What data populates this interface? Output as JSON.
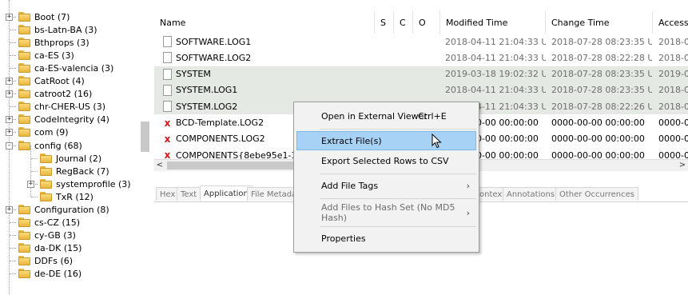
{
  "tree": {
    "items": [
      {
        "label": "Boot (7)",
        "expander": "+"
      },
      {
        "label": "bs-Latn-BA (3)",
        "expander": ""
      },
      {
        "label": "Bthprops (3)",
        "expander": ""
      },
      {
        "label": "ca-ES (3)",
        "expander": ""
      },
      {
        "label": "ca-ES-valencia (3)",
        "expander": ""
      },
      {
        "label": "CatRoot (4)",
        "expander": "+"
      },
      {
        "label": "catroot2 (16)",
        "expander": "+"
      },
      {
        "label": "chr-CHER-US (3)",
        "expander": ""
      },
      {
        "label": "CodeIntegrity (4)",
        "expander": "+"
      },
      {
        "label": "com (9)",
        "expander": "+"
      },
      {
        "label": "config (68)",
        "expander": "-"
      },
      {
        "label": "Journal (2)",
        "expander": ""
      },
      {
        "label": "RegBack (7)",
        "expander": ""
      },
      {
        "label": "systemprofile (3)",
        "expander": "+"
      },
      {
        "label": "TxR (12)",
        "expander": ""
      },
      {
        "label": "Configuration (8)",
        "expander": "+"
      },
      {
        "label": "cs-CZ (15)",
        "expander": ""
      },
      {
        "label": "cy-GB (3)",
        "expander": ""
      },
      {
        "label": "da-DK (15)",
        "expander": ""
      },
      {
        "label": "DDFs (6)",
        "expander": ""
      },
      {
        "label": "de-DE (16)",
        "expander": ""
      }
    ]
  },
  "table": {
    "columns": [
      "Name",
      "S",
      "C",
      "O",
      "Modified Time",
      "Change Time",
      "Access"
    ],
    "rows": [
      {
        "name": "SOFTWARE.LOG1",
        "icon": "file-icon",
        "modified": "2018-04-11 21:04:33 UTC",
        "change": "2018-07-28 08:23:35 UTC",
        "access": "2018-0",
        "highlight": false
      },
      {
        "name": "SOFTWARE.LOG2",
        "icon": "file-icon",
        "modified": "2018-04-11 21:04:33 UTC",
        "change": "2018-07-28 08:22:28 UTC",
        "access": "2018-0",
        "highlight": false
      },
      {
        "name": "SYSTEM",
        "icon": "file-icon",
        "modified": "2019-03-18 19:02:32 UTC",
        "change": "2018-07-28 08:23:35 UTC",
        "access": "2019-0",
        "highlight": true
      },
      {
        "name": "SYSTEM.LOG1",
        "icon": "file-icon",
        "modified": "2018-04-11 21:04:33 UTC",
        "change": "2018-07-28 08:23:35 UTC",
        "access": "2018-0",
        "highlight": true
      },
      {
        "name": "SYSTEM.LOG2",
        "icon": "file-icon",
        "modified": "2018-04-11 21:04:33 UTC",
        "change": "2018-07-28 08:22:26 UTC",
        "access": "2018-0",
        "highlight": true
      },
      {
        "name": "BCD-Template.LOG2",
        "icon": "deleted-x-icon",
        "modified": "0000-00-00 00:00:00",
        "change": "0000-00-00 00:00:00",
        "access": "0000-0",
        "highlight": false
      },
      {
        "name": "COMPONENTS.LOG2",
        "icon": "deleted-x-icon",
        "modified": "0000-00-00 00:00:00",
        "change": "0000-00-00 00:00:00",
        "access": "0000-0",
        "highlight": false
      },
      {
        "name": "COMPONENTS{8ebe95e1-3dcb-1",
        "icon": "deleted-x-icon",
        "modified": "0000-00-00 00:00:00",
        "change": "0000-00-00 00:00:00",
        "access": "0000-0",
        "highlight": false
      }
    ],
    "scroll_left": "<",
    "scroll_right": ">"
  },
  "bottom_tabs": [
    "Hex",
    "Text",
    "Application",
    "File Metadata",
    "ontext",
    "Annotations",
    "Other Occurrences"
  ],
  "active_tab": "Application",
  "context_menu": {
    "items": [
      {
        "label": "Open in External Viewer",
        "shortcut": "Ctrl+E",
        "submenu": false,
        "selected": false,
        "disabled": false
      },
      {
        "label": "Extract File(s)",
        "shortcut": "",
        "submenu": false,
        "selected": true,
        "disabled": false
      },
      {
        "label": "Export Selected Rows to CSV",
        "shortcut": "",
        "submenu": false,
        "selected": false,
        "disabled": false
      },
      {
        "label": "Add File Tags",
        "shortcut": "",
        "submenu": true,
        "selected": false,
        "disabled": false
      },
      {
        "label": "Add Files to Hash Set (No MD5 Hash)",
        "shortcut": "",
        "submenu": true,
        "selected": false,
        "disabled": true
      },
      {
        "label": "Properties",
        "shortcut": "",
        "submenu": false,
        "selected": false,
        "disabled": false
      }
    ]
  },
  "colors": {
    "row_highlight": "#e4e9e4",
    "menu_selected": "#a8d2f5",
    "folder": "#f1c95b",
    "deleted_icon": "#d21a1a"
  }
}
